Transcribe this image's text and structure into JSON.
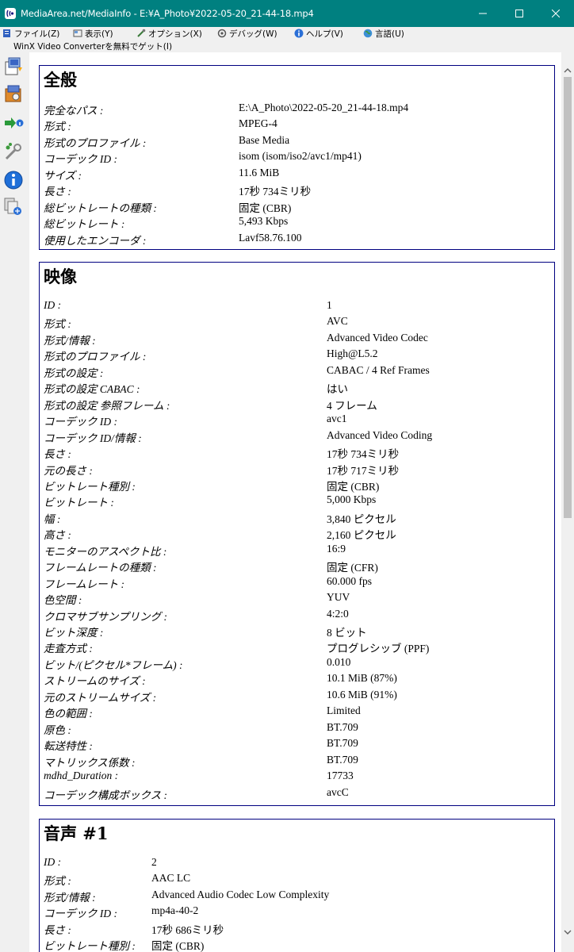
{
  "window": {
    "title": "MediaArea.net/MediaInfo - E:¥A_Photo¥2022-05-20_21-44-18.mp4",
    "minimize": "—",
    "maximize": "☐",
    "close": "✕"
  },
  "menu": {
    "file": "ファイル(Z)",
    "view": "表示(Y)",
    "options": "オプション(X)",
    "debug": "デバッグ(W)",
    "help": "ヘルプ(V)",
    "language": "言語(U)",
    "promo": "WinX Video Converterを無料でゲット(I)"
  },
  "toolbar": {
    "icons": [
      "open-file-icon",
      "open-folder-icon",
      "export-icon",
      "preferences-icon",
      "about-icon",
      "knowledge-base-icon"
    ]
  },
  "general": {
    "heading": "全般",
    "rows": [
      {
        "k": "完全なパス :",
        "v": "E:\\A_Photo\\2022-05-20_21-44-18.mp4"
      },
      {
        "k": "形式 :",
        "v": "MPEG-4"
      },
      {
        "k": "形式のプロファイル :",
        "v": "Base Media"
      },
      {
        "k": "コーデック ID :",
        "v": "isom (isom/iso2/avc1/mp41)"
      },
      {
        "k": "サイズ :",
        "v": "11.6 MiB"
      },
      {
        "k": "長さ :",
        "v": "17秒 734ミリ秒"
      },
      {
        "k": "総ビットレートの種類 :",
        "v": "固定 (CBR)"
      },
      {
        "k": "総ビットレート :",
        "v": "5,493 Kbps"
      },
      {
        "k": "使用したエンコーダ :",
        "v": "Lavf58.76.100"
      }
    ]
  },
  "video": {
    "heading": "映像",
    "rows": [
      {
        "k": "ID :",
        "v": "1"
      },
      {
        "k": "形式 :",
        "v": "AVC"
      },
      {
        "k": "形式/情報 :",
        "v": "Advanced Video Codec"
      },
      {
        "k": "形式のプロファイル :",
        "v": "High@L5.2"
      },
      {
        "k": "形式の設定 :",
        "v": "CABAC / 4 Ref Frames"
      },
      {
        "k": "形式の設定 CABAC :",
        "v": "はい"
      },
      {
        "k": "形式の設定 参照フレーム :",
        "v": "4 フレーム"
      },
      {
        "k": "コーデック ID :",
        "v": "avc1"
      },
      {
        "k": "コーデック ID/情報 :",
        "v": "Advanced Video Coding"
      },
      {
        "k": "長さ :",
        "v": "17秒 734ミリ秒"
      },
      {
        "k": "元の長さ :",
        "v": "17秒 717ミリ秒"
      },
      {
        "k": "ビットレート種別 :",
        "v": "固定 (CBR)"
      },
      {
        "k": "ビットレート :",
        "v": "5,000 Kbps"
      },
      {
        "k": "幅 :",
        "v": "3,840 ピクセル"
      },
      {
        "k": "高さ :",
        "v": "2,160 ピクセル"
      },
      {
        "k": "モニターのアスペクト比 :",
        "v": "16:9"
      },
      {
        "k": "フレームレートの種類 :",
        "v": "固定 (CFR)"
      },
      {
        "k": "フレームレート :",
        "v": "60.000 fps"
      },
      {
        "k": "色空間 :",
        "v": "YUV"
      },
      {
        "k": "クロマサブサンプリング :",
        "v": "4:2:0"
      },
      {
        "k": "ビット深度 :",
        "v": "8 ビット"
      },
      {
        "k": "走査方式 :",
        "v": "プログレシッブ (PPF)"
      },
      {
        "k": "ビット/(ピクセル*フレーム) :",
        "v": "0.010"
      },
      {
        "k": "ストリームのサイズ :",
        "v": "10.1 MiB (87%)"
      },
      {
        "k": "元のストリームサイズ :",
        "v": "10.6 MiB (91%)"
      },
      {
        "k": "色の範囲 :",
        "v": "Limited"
      },
      {
        "k": "原色 :",
        "v": "BT.709"
      },
      {
        "k": "転送特性 :",
        "v": "BT.709"
      },
      {
        "k": "マトリックス係数 :",
        "v": "BT.709"
      },
      {
        "k": "mdhd_Duration :",
        "v": "17733"
      },
      {
        "k": "コーデック構成ボックス :",
        "v": "avcC"
      }
    ]
  },
  "audio": {
    "heading": "音声 #1",
    "rows": [
      {
        "k": "ID :",
        "v": "2"
      },
      {
        "k": "形式 :",
        "v": "AAC LC"
      },
      {
        "k": "形式/情報 :",
        "v": "Advanced Audio Codec Low Complexity"
      },
      {
        "k": "コーデック ID :",
        "v": "mp4a-40-2"
      },
      {
        "k": "長さ :",
        "v": "17秒 686ミリ秒"
      },
      {
        "k": "ビットレート種別 :",
        "v": "固定 (CBR)"
      }
    ]
  }
}
